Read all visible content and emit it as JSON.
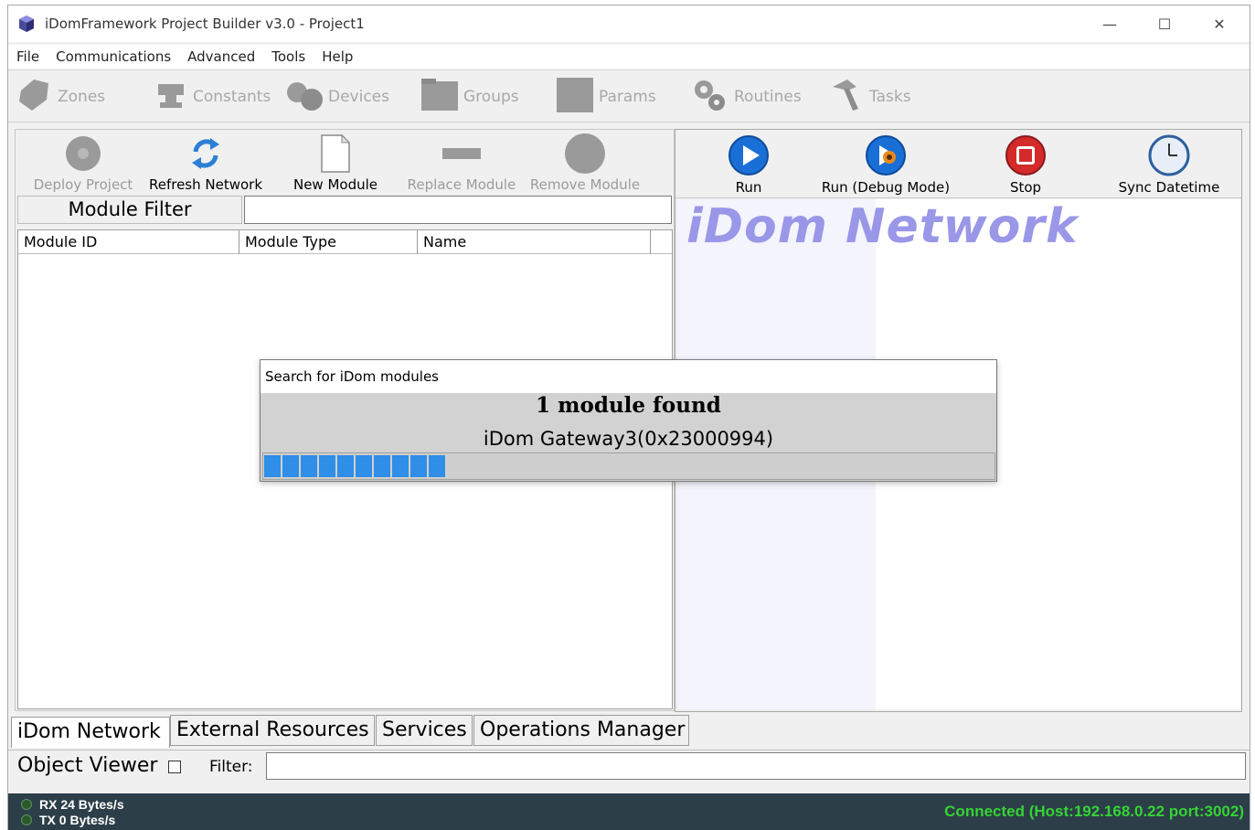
{
  "window": {
    "title": "iDomFramework Project Builder v3.0 - Project1",
    "controls": {
      "minimize": "—",
      "maximize": "☐",
      "close": "✕"
    }
  },
  "menu": [
    "File",
    "Communications",
    "Advanced",
    "Tools",
    "Help"
  ],
  "main_toolbar": [
    {
      "label": "Zones",
      "icon": "tag-icon"
    },
    {
      "label": "Constants",
      "icon": "anvil-icon"
    },
    {
      "label": "Devices",
      "icon": "devices-icon"
    },
    {
      "label": "Groups",
      "icon": "folder-icon"
    },
    {
      "label": "Params",
      "icon": "params-icon"
    },
    {
      "label": "Routines",
      "icon": "gears-icon"
    },
    {
      "label": "Tasks",
      "icon": "hammer-icon"
    }
  ],
  "left_toolbar": [
    {
      "label": "Deploy Project",
      "icon": "gear-icon",
      "enabled": false
    },
    {
      "label": "Refresh Network",
      "icon": "refresh-icon",
      "enabled": true
    },
    {
      "label": "New Module",
      "icon": "new-document-icon",
      "enabled": true
    },
    {
      "label": "Replace Module",
      "icon": "replace-icon",
      "enabled": false
    },
    {
      "label": "Remove Module",
      "icon": "remove-icon",
      "enabled": false
    }
  ],
  "module_filter": {
    "label": "Module Filter",
    "value": ""
  },
  "grid": {
    "columns": [
      "Module ID",
      "Module Type",
      "Name"
    ],
    "rows": []
  },
  "right_toolbar": [
    {
      "label": "Run",
      "icon": "play-icon"
    },
    {
      "label": "Run (Debug Mode)",
      "icon": "debug-icon"
    },
    {
      "label": "Stop",
      "icon": "stop-icon"
    },
    {
      "label": "Sync Datetime",
      "icon": "clock-icon"
    }
  ],
  "network_canvas": {
    "watermark": "iDom Network"
  },
  "bottom_tabs": [
    {
      "label": "iDom Network",
      "active": true
    },
    {
      "label": "External Resources",
      "active": false
    },
    {
      "label": "Services",
      "active": false
    },
    {
      "label": "Operations Manager",
      "active": false
    }
  ],
  "object_viewer": {
    "label": "Object Viewer",
    "checked": false,
    "filter_label": "Filter:",
    "filter_value": ""
  },
  "status": {
    "rx": "RX 24 Bytes/s",
    "tx": "TX 0 Bytes/s",
    "connection": "Connected (Host:192.168.0.22 port:3002)",
    "connection_color": "#35d335"
  },
  "dialog": {
    "title": "Search for iDom modules",
    "heading": "1 module found",
    "device": "iDom Gateway3(0x23000994)",
    "progress_segments": 10,
    "progress_fraction": 0.25,
    "accent_color": "#2f8ee7"
  }
}
